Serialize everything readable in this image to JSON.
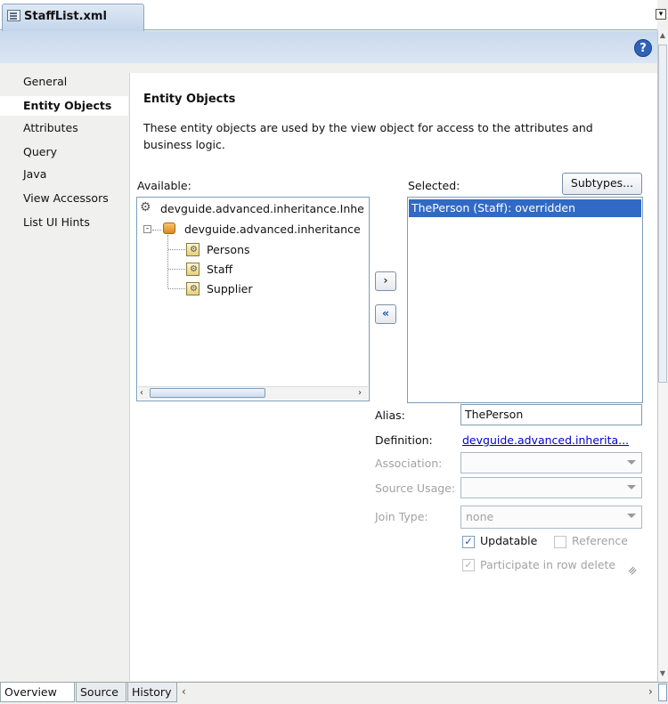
{
  "tab": {
    "title": "StaffList.xml",
    "file_icon": "xml-file-icon"
  },
  "header": {
    "help_label": "?"
  },
  "nav": {
    "items": [
      {
        "label": "General"
      },
      {
        "label": "Entity Objects"
      },
      {
        "label": "Attributes"
      },
      {
        "label": "Query"
      },
      {
        "label": "Java"
      },
      {
        "label": "View Accessors"
      },
      {
        "label": "List UI Hints"
      }
    ],
    "selected": "Entity Objects"
  },
  "main": {
    "title": "Entity Objects",
    "description_line1": "These entity objects are used by the view object for access to the attributes and",
    "description_line2": "business logic.",
    "available_label": "Available:",
    "selected_label": "Selected:",
    "subtypes_button": "Subtypes...",
    "tree": {
      "root": "devguide.advanced.inheritance.Inhe",
      "package": "devguide.advanced.inheritance",
      "collapse_symbol": "-",
      "entities": [
        "Persons",
        "Staff",
        "Supplier"
      ]
    },
    "shuttle": {
      "add": "›",
      "remove": "«"
    },
    "selected_items": [
      "ThePerson (Staff): overridden"
    ],
    "fields": {
      "alias_label": "Alias:",
      "alias_value": "ThePerson",
      "definition_label": "Definition:",
      "definition_value": "devguide.advanced.inherita...",
      "association_label": "Association:",
      "association_value": "",
      "source_usage_label": "Source Usage:",
      "source_usage_value": "",
      "join_type_label": "Join Type:",
      "join_type_value": "none"
    },
    "checkboxes": {
      "updatable": {
        "label": "Updatable",
        "checked": true
      },
      "reference": {
        "label": "Reference",
        "checked": false
      },
      "participate": {
        "label": "Participate in row delete",
        "checked": true
      }
    }
  },
  "bottom_tabs": [
    {
      "label": "Overview"
    },
    {
      "label": "Source"
    },
    {
      "label": "History"
    }
  ],
  "colors": {
    "selection": "#316ac5",
    "link": "#0000cc",
    "band": "#c9d9ec"
  }
}
